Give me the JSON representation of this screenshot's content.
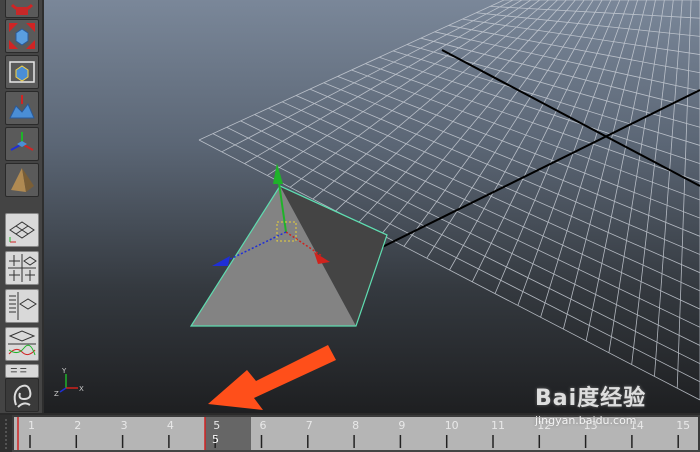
{
  "toolbar": {
    "tools": [
      {
        "name": "rotate-tool",
        "icon": "rotate-icon"
      },
      {
        "name": "scale-tool",
        "icon": "scale-icon"
      },
      {
        "name": "universal-manipulator-tool",
        "icon": "universal-manipulator-icon"
      },
      {
        "name": "soft-modification-tool",
        "icon": "soft-mod-icon"
      },
      {
        "name": "show-manipulator-tool",
        "icon": "show-manipulator-icon"
      },
      {
        "name": "last-tool-used",
        "icon": "pyramid-icon"
      }
    ],
    "layouts": [
      {
        "name": "single-perspective-layout",
        "icon": "single-view-icon"
      },
      {
        "name": "four-view-layout",
        "icon": "four-view-icon"
      },
      {
        "name": "outliner-persp-layout",
        "icon": "outliner-persp-icon"
      },
      {
        "name": "graph-editor-layout",
        "icon": "graph-persp-icon"
      },
      {
        "name": "more-layouts",
        "icon": "list-layout-icon"
      }
    ],
    "bottom_tool": {
      "name": "sculpt-tool",
      "icon": "sculpt-icon"
    }
  },
  "viewport": {
    "selected_object": "pyramid",
    "selection_color": "#5fdcb0",
    "axis_colors": {
      "x": "#d0221c",
      "y": "#1fb32a",
      "z": "#1f2fd6"
    },
    "axis_indicator": [
      "x",
      "y",
      "z"
    ],
    "annotation_arrow_color": "#ff4f1a"
  },
  "timeline": {
    "frames": [
      "1",
      "2",
      "3",
      "4",
      "5",
      "6",
      "7",
      "8",
      "9",
      "10",
      "11",
      "12",
      "13",
      "14",
      "15"
    ],
    "current_frame": "5"
  },
  "watermark": {
    "brand": "Bai度经验",
    "url": "jingyan.baidu.com"
  }
}
